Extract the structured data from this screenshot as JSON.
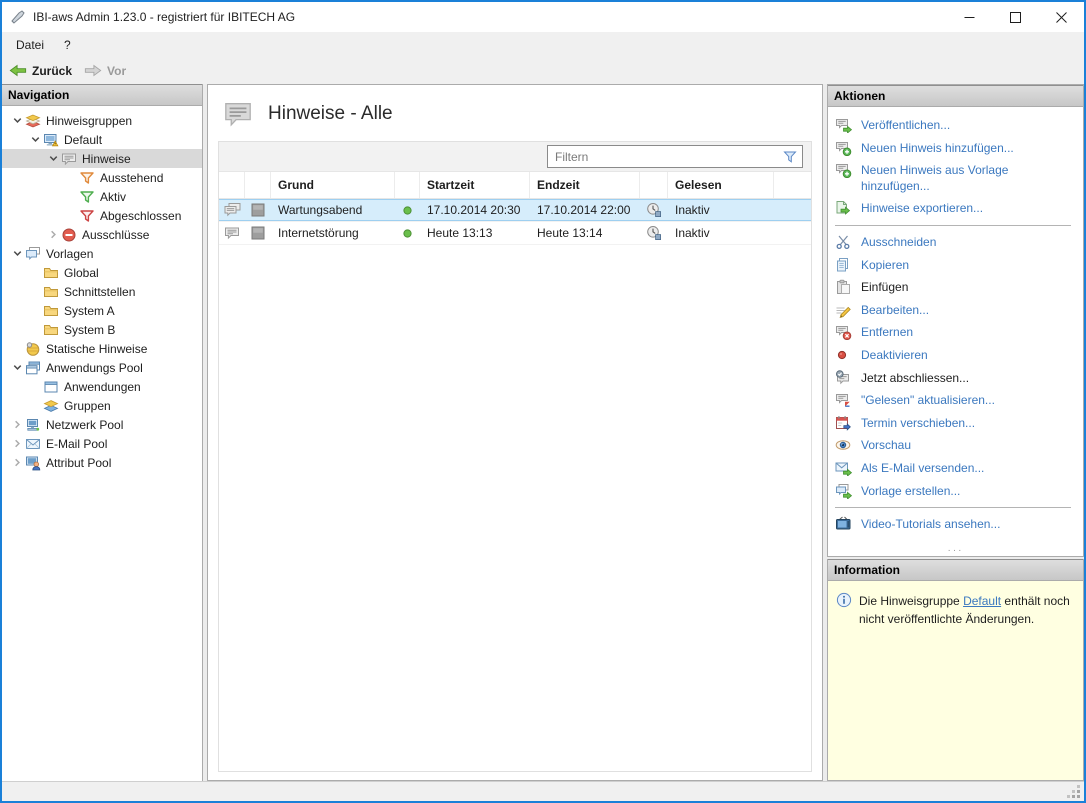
{
  "window": {
    "title": "IBI-aws Admin 1.23.0 - registriert für IBITECH AG"
  },
  "menu": {
    "items": [
      "Datei",
      "?"
    ]
  },
  "toolbar": {
    "back_label": "Zurück",
    "forward_label": "Vor"
  },
  "navigation": {
    "header": "Navigation",
    "items": [
      {
        "label": "Hinweisgruppen",
        "level": 0,
        "chevron": "down",
        "icon": "group-stack-icon",
        "selected": false
      },
      {
        "label": "Default",
        "level": 1,
        "chevron": "down",
        "icon": "monitor-warning-icon",
        "selected": false
      },
      {
        "label": "Hinweise",
        "level": 2,
        "chevron": "down",
        "icon": "speech-bubble-icon",
        "selected": true
      },
      {
        "label": "Ausstehend",
        "level": 3,
        "chevron": "none",
        "icon": "funnel-orange-icon",
        "selected": false
      },
      {
        "label": "Aktiv",
        "level": 3,
        "chevron": "none",
        "icon": "funnel-green-icon",
        "selected": false
      },
      {
        "label": "Abgeschlossen",
        "level": 3,
        "chevron": "none",
        "icon": "funnel-red-icon",
        "selected": false
      },
      {
        "label": "Ausschlüsse",
        "level": 2,
        "chevron": "right",
        "icon": "minus-circle-icon",
        "selected": false
      },
      {
        "label": "Vorlagen",
        "level": 0,
        "chevron": "down",
        "icon": "templates-icon",
        "selected": false
      },
      {
        "label": "Global",
        "level": 1,
        "chevron": "none",
        "icon": "folder-icon",
        "selected": false
      },
      {
        "label": "Schnittstellen",
        "level": 1,
        "chevron": "none",
        "icon": "folder-icon",
        "selected": false
      },
      {
        "label": "System A",
        "level": 1,
        "chevron": "none",
        "icon": "folder-icon",
        "selected": false
      },
      {
        "label": "System B",
        "level": 1,
        "chevron": "none",
        "icon": "folder-icon",
        "selected": false
      },
      {
        "label": "Statische Hinweise",
        "level": 0,
        "chevron": "none",
        "icon": "static-package-icon",
        "selected": false
      },
      {
        "label": "Anwendungs Pool",
        "level": 0,
        "chevron": "down",
        "icon": "app-windows-icon",
        "selected": false
      },
      {
        "label": "Anwendungen",
        "level": 1,
        "chevron": "none",
        "icon": "app-window-icon",
        "selected": false
      },
      {
        "label": "Gruppen",
        "level": 1,
        "chevron": "none",
        "icon": "group-stack2-icon",
        "selected": false
      },
      {
        "label": "Netzwerk Pool",
        "level": 0,
        "chevron": "right",
        "icon": "network-monitor-icon",
        "selected": false
      },
      {
        "label": "E-Mail Pool",
        "level": 0,
        "chevron": "right",
        "icon": "mail-icon",
        "selected": false
      },
      {
        "label": "Attribut Pool",
        "level": 0,
        "chevron": "right",
        "icon": "user-monitor-icon",
        "selected": false
      }
    ]
  },
  "main": {
    "title": "Hinweise - Alle",
    "title_icon": "speech-bubble-icon",
    "filter_placeholder": "Filtern",
    "filter_icon": "funnel-icon",
    "table": {
      "columns": [
        "",
        "",
        "Grund",
        "",
        "Startzeit",
        "Endzeit",
        "",
        "Gelesen",
        ""
      ],
      "rows": [
        {
          "type_icon": "double-speech-bubble-icon",
          "box_icon": "gray-square-icon",
          "grund": "Wartungsabend",
          "status_icon": "green-dot-icon",
          "startzeit": "17.10.2014 20:30",
          "endzeit": "17.10.2014 22:00",
          "gelesen_icon": "clock-history-icon",
          "gelesen": "Inaktiv",
          "selected": true
        },
        {
          "type_icon": "speech-bubble-icon",
          "box_icon": "gray-square-icon",
          "grund": "Internetstörung",
          "status_icon": "green-dot-icon",
          "startzeit": "Heute 13:13",
          "endzeit": "Heute 13:14",
          "gelesen_icon": "clock-history-icon",
          "gelesen": "Inaktiv",
          "selected": false
        }
      ]
    }
  },
  "actions": {
    "header": "Aktionen",
    "items": [
      {
        "label": "Veröffentlichen...",
        "icon": "publish-icon",
        "enabled": true,
        "separator_after": false
      },
      {
        "label": "Neuen Hinweis hinzufügen...",
        "icon": "add-hint-icon",
        "enabled": true,
        "separator_after": false
      },
      {
        "label": "Neuen Hinweis aus Vorlage hinzufügen...",
        "icon": "add-hint-icon",
        "enabled": true,
        "separator_after": false
      },
      {
        "label": "Hinweise exportieren...",
        "icon": "export-icon",
        "enabled": true,
        "separator_after": true
      },
      {
        "label": "Ausschneiden",
        "icon": "scissors-icon",
        "enabled": true,
        "separator_after": false
      },
      {
        "label": "Kopieren",
        "icon": "copy-icon",
        "enabled": true,
        "separator_after": false
      },
      {
        "label": "Einfügen",
        "icon": "paste-icon",
        "enabled": false,
        "separator_after": false
      },
      {
        "label": "Bearbeiten...",
        "icon": "edit-pencil-icon",
        "enabled": true,
        "separator_after": false
      },
      {
        "label": "Entfernen",
        "icon": "remove-icon",
        "enabled": true,
        "separator_after": false
      },
      {
        "label": "Deaktivieren",
        "icon": "red-dot-icon",
        "enabled": true,
        "separator_after": false
      },
      {
        "label": "Jetzt abschliessen...",
        "icon": "complete-icon",
        "enabled": false,
        "separator_after": false
      },
      {
        "label": "\"Gelesen\" aktualisieren...",
        "icon": "refresh-read-icon",
        "enabled": true,
        "separator_after": false
      },
      {
        "label": "Termin verschieben...",
        "icon": "calendar-move-icon",
        "enabled": true,
        "separator_after": false
      },
      {
        "label": "Vorschau",
        "icon": "eye-icon",
        "enabled": true,
        "separator_after": false
      },
      {
        "label": "Als E-Mail versenden...",
        "icon": "send-mail-icon",
        "enabled": true,
        "separator_after": false
      },
      {
        "label": "Vorlage erstellen...",
        "icon": "create-template-icon",
        "enabled": true,
        "separator_after": true
      },
      {
        "label": "Video-Tutorials ansehen...",
        "icon": "tv-icon",
        "enabled": true,
        "separator_after": false
      }
    ],
    "splitter_dots": "···"
  },
  "information": {
    "header": "Information",
    "icon": "info-icon",
    "text_before": "Die Hinweisgruppe ",
    "link": "Default",
    "text_after": " enthält noch nicht veröffentlichte Änderungen."
  },
  "colors": {
    "window_border": "#1a80d8",
    "link_blue": "#3b78bf",
    "selection_blue": "#d6edfb",
    "nav_selection_gray": "#d9d9d9",
    "info_background": "#ffffe1",
    "panel_header_gray": "#cccccc"
  }
}
